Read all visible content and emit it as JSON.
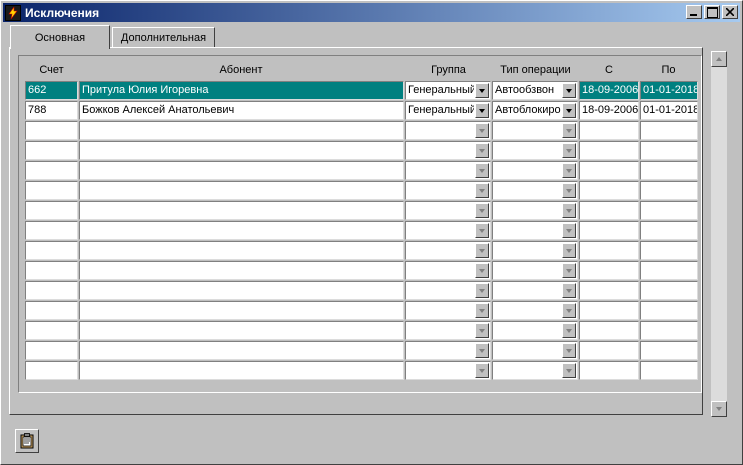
{
  "window": {
    "title": "Исключения"
  },
  "tabs": [
    {
      "label": "Основная",
      "active": true
    },
    {
      "label": "Дополнительная",
      "active": false
    }
  ],
  "grid": {
    "columns": [
      "Счет",
      "Абонент",
      "Группа",
      "Тип операции",
      "С",
      "По"
    ],
    "rows": [
      {
        "account": "662",
        "subscriber": "Притула Юлия Игоревна",
        "group": "Генеральный",
        "operation": "Автообзвон",
        "from": "18-09-2006",
        "to": "01-01-2018",
        "selected": true
      },
      {
        "account": "788",
        "subscriber": "Божков Алексей Анатольевич",
        "group": "Генеральный",
        "operation": "Автоблокировка",
        "from": "18-09-2006",
        "to": "01-01-2018",
        "selected": false
      }
    ],
    "empty_rows": 13,
    "selection_color": "#008080"
  },
  "icons": {
    "app": "lightning-app-icon",
    "clipboard": "clipboard-icon"
  }
}
